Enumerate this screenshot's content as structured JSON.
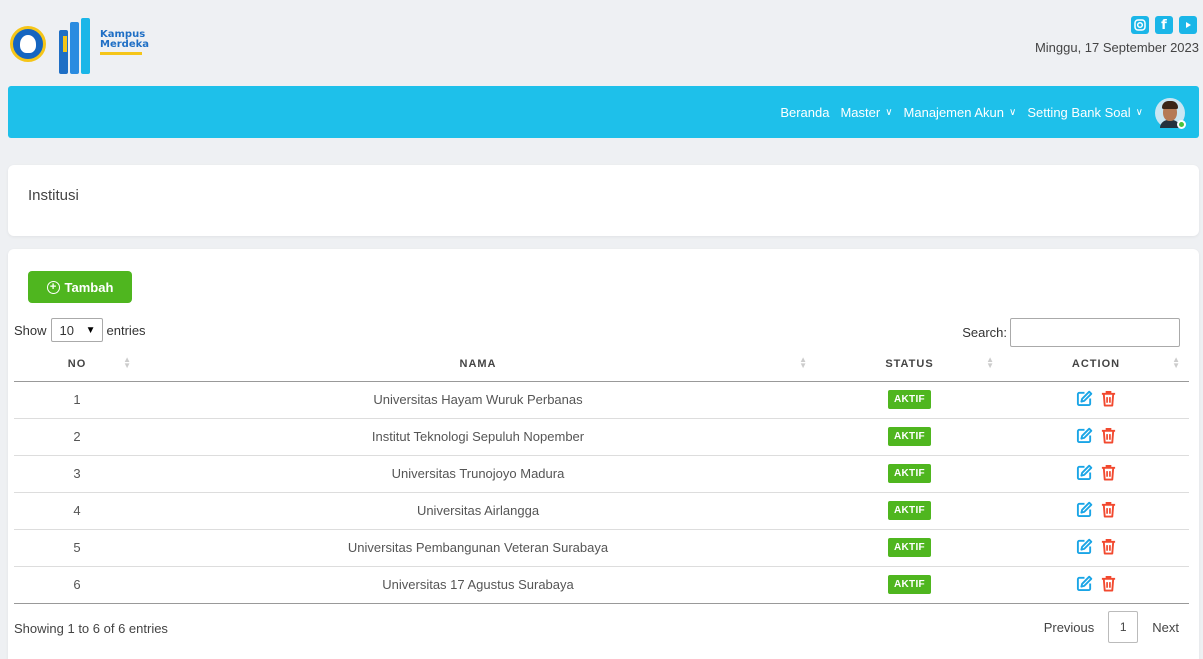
{
  "header": {
    "date": "Minggu, 17 September 2023",
    "logo_text_1": "Kampus",
    "logo_text_2": "Merdeka"
  },
  "nav": {
    "items": [
      {
        "label": "Beranda",
        "dropdown": false
      },
      {
        "label": "Master",
        "dropdown": true
      },
      {
        "label": "Manajemen Akun",
        "dropdown": true
      },
      {
        "label": "Setting Bank Soal",
        "dropdown": true
      }
    ]
  },
  "page": {
    "title": "Institusi",
    "add_button": "Tambah",
    "show_label": "Show",
    "entries_label": "entries",
    "page_length": "10",
    "search_label": "Search:",
    "search_value": ""
  },
  "table": {
    "headers": [
      "NO",
      "NAMA",
      "STATUS",
      "ACTION"
    ],
    "rows": [
      {
        "no": "1",
        "nama": "Universitas Hayam Wuruk Perbanas",
        "status": "AKTIF"
      },
      {
        "no": "2",
        "nama": "Institut Teknologi Sepuluh Nopember",
        "status": "AKTIF"
      },
      {
        "no": "3",
        "nama": "Universitas Trunojoyo Madura",
        "status": "AKTIF"
      },
      {
        "no": "4",
        "nama": "Universitas Airlangga",
        "status": "AKTIF"
      },
      {
        "no": "5",
        "nama": "Universitas Pembangunan Veteran Surabaya",
        "status": "AKTIF"
      },
      {
        "no": "6",
        "nama": "Universitas 17 Agustus Surabaya",
        "status": "AKTIF"
      }
    ]
  },
  "footer": {
    "info": "Showing 1 to 6 of 6 entries",
    "previous": "Previous",
    "current_page": "1",
    "next": "Next"
  },
  "colors": {
    "navbar": "#1ec0ea",
    "success": "#4fb61f",
    "edit_icon": "#1aa5e6",
    "delete_icon": "#f2492f"
  },
  "icons": [
    "instagram-icon",
    "facebook-icon",
    "youtube-icon",
    "edit-icon",
    "trash-icon",
    "plus-circle-icon"
  ]
}
